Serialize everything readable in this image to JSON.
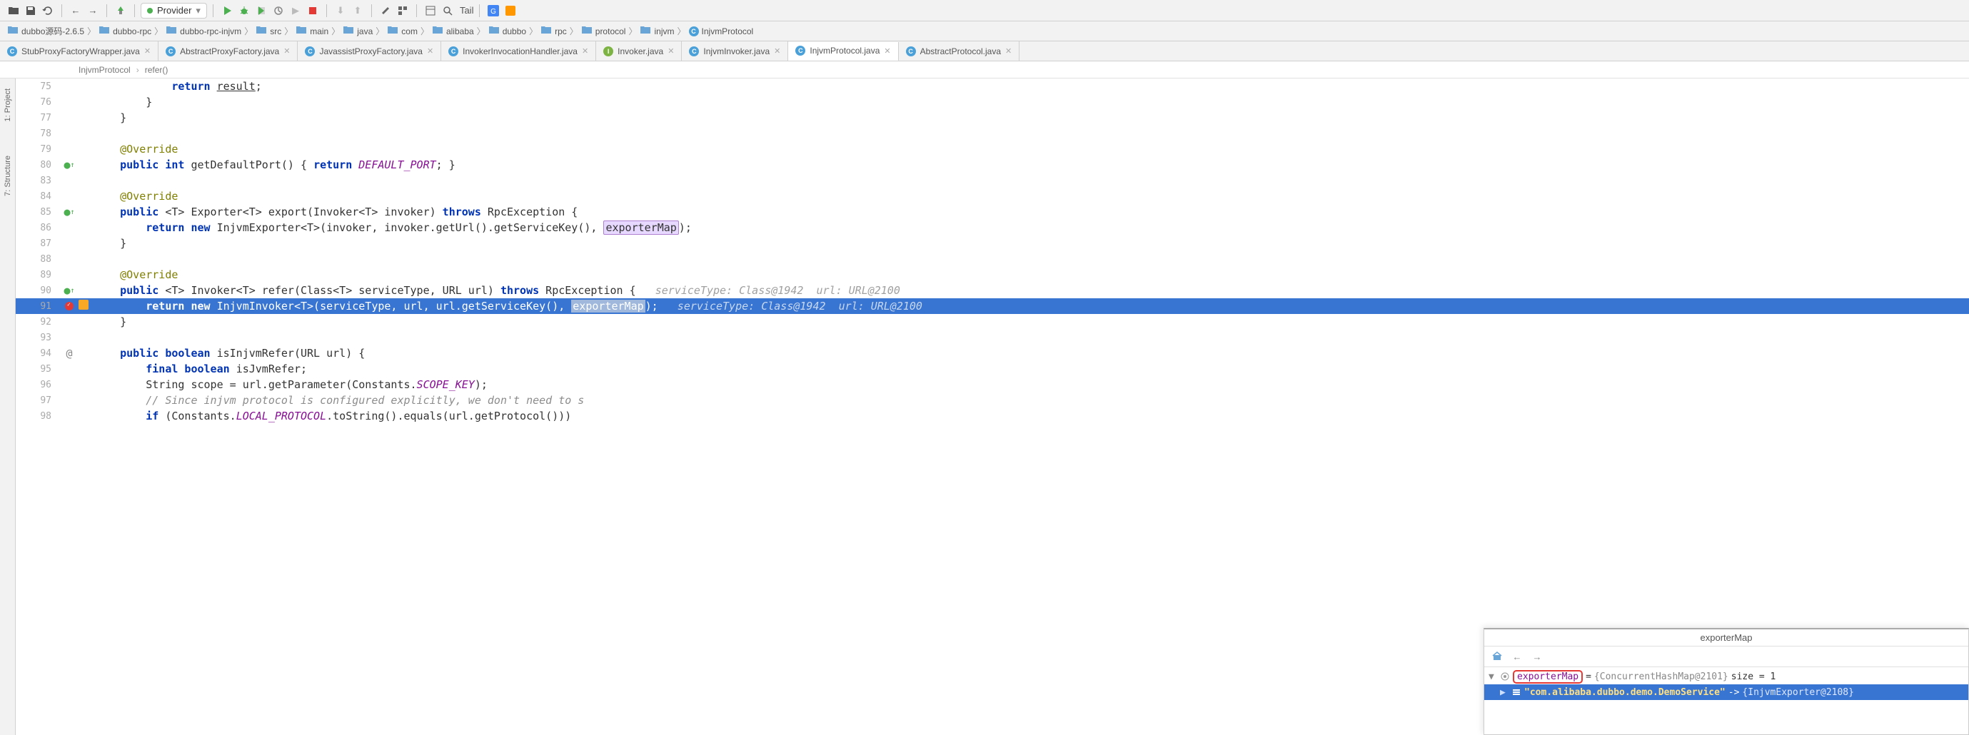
{
  "toolbar": {
    "run_config": "Provider",
    "search_text": "Tail"
  },
  "breadcrumbs": [
    {
      "icon": "folder",
      "label": "dubbo源码-2.6.5"
    },
    {
      "icon": "folder",
      "label": "dubbo-rpc"
    },
    {
      "icon": "folder",
      "label": "dubbo-rpc-injvm"
    },
    {
      "icon": "folder-src",
      "label": "src"
    },
    {
      "icon": "folder-src",
      "label": "main"
    },
    {
      "icon": "folder-src",
      "label": "java"
    },
    {
      "icon": "folder-pkg",
      "label": "com"
    },
    {
      "icon": "folder-pkg",
      "label": "alibaba"
    },
    {
      "icon": "folder-pkg",
      "label": "dubbo"
    },
    {
      "icon": "folder-pkg",
      "label": "rpc"
    },
    {
      "icon": "folder-pkg",
      "label": "protocol"
    },
    {
      "icon": "folder-pkg",
      "label": "injvm"
    },
    {
      "icon": "class",
      "label": "InjvmProtocol"
    }
  ],
  "tabs": [
    {
      "label": "StubProxyFactoryWrapper.java",
      "icon": "class",
      "active": false
    },
    {
      "label": "AbstractProxyFactory.java",
      "icon": "class",
      "active": false
    },
    {
      "label": "JavassistProxyFactory.java",
      "icon": "class",
      "active": false
    },
    {
      "label": "InvokerInvocationHandler.java",
      "icon": "class",
      "active": false
    },
    {
      "label": "Invoker.java",
      "icon": "interface",
      "active": false
    },
    {
      "label": "InjvmInvoker.java",
      "icon": "class",
      "active": false
    },
    {
      "label": "InjvmProtocol.java",
      "icon": "class",
      "active": true
    },
    {
      "label": "AbstractProtocol.java",
      "icon": "class",
      "active": false
    }
  ],
  "sub_crumb": {
    "class": "InjvmProtocol",
    "method": "refer()"
  },
  "side_tabs": [
    "1: Project",
    "7: Structure"
  ],
  "code_lines": [
    {
      "num": 75,
      "code": "            return result;",
      "tokens": [
        {
          "t": "            "
        },
        {
          "t": "return ",
          "c": "kw"
        },
        {
          "t": "result",
          "c": "underline"
        },
        {
          "t": ";"
        }
      ]
    },
    {
      "num": 76,
      "code": "        }"
    },
    {
      "num": 77,
      "code": "    }"
    },
    {
      "num": 78,
      "code": ""
    },
    {
      "num": 79,
      "code": "    @Override",
      "fold": true,
      "tokens": [
        {
          "t": "    "
        },
        {
          "t": "@Override",
          "c": "ann"
        }
      ]
    },
    {
      "num": 80,
      "marker": "override",
      "code": "    public int getDefaultPort() { return DEFAULT_PORT; }",
      "tokens": [
        {
          "t": "    "
        },
        {
          "t": "public int ",
          "c": "kw"
        },
        {
          "t": "getDefaultPort() { "
        },
        {
          "t": "return ",
          "c": "kw"
        },
        {
          "t": "DEFAULT_PORT",
          "c": "purple"
        },
        {
          "t": "; }"
        }
      ]
    },
    {
      "num": 83,
      "code": ""
    },
    {
      "num": 84,
      "code": "    @Override",
      "fold": true,
      "tokens": [
        {
          "t": "    "
        },
        {
          "t": "@Override",
          "c": "ann"
        }
      ]
    },
    {
      "num": 85,
      "marker": "override",
      "code": "    public <T> Exporter<T> export(Invoker<T> invoker) throws RpcException {",
      "tokens": [
        {
          "t": "    "
        },
        {
          "t": "public ",
          "c": "kw"
        },
        {
          "t": "<T> Exporter<T> export(Invoker<T> invoker) "
        },
        {
          "t": "throws ",
          "c": "kw"
        },
        {
          "t": "RpcException {"
        }
      ]
    },
    {
      "num": 86,
      "code": "        return new InjvmExporter<T>(invoker, invoker.getUrl().getServiceKey(), exporterMap);",
      "tokens": [
        {
          "t": "        "
        },
        {
          "t": "return new ",
          "c": "kw"
        },
        {
          "t": "InjvmExporter<T>(invoker, invoker.getUrl().getServiceKey(), "
        },
        {
          "t": "exporterMap",
          "c": "hl-box"
        },
        {
          "t": ");"
        }
      ]
    },
    {
      "num": 87,
      "code": "    }"
    },
    {
      "num": 88,
      "code": ""
    },
    {
      "num": 89,
      "code": "    @Override",
      "fold": true,
      "tokens": [
        {
          "t": "    "
        },
        {
          "t": "@Override",
          "c": "ann"
        }
      ]
    },
    {
      "num": 90,
      "marker": "override",
      "code": "    public <T> Invoker<T> refer(Class<T> serviceType, URL url) throws RpcException {",
      "tokens": [
        {
          "t": "    "
        },
        {
          "t": "public ",
          "c": "kw"
        },
        {
          "t": "<T> Invoker<T> refer(Class<T> serviceType, URL url) "
        },
        {
          "t": "throws ",
          "c": "kw"
        },
        {
          "t": "RpcException {   "
        },
        {
          "t": "serviceType: Class@1942  url: URL@2100",
          "c": "inline-hint"
        }
      ]
    },
    {
      "num": 91,
      "marker": "breakpoint",
      "highlighted": true,
      "code": "        return new InjvmInvoker<T>(serviceType, url, url.getServiceKey(), exporterMap);",
      "tokens": [
        {
          "t": "        "
        },
        {
          "t": "return new ",
          "c": "kw"
        },
        {
          "t": "InjvmInvoker<T>(serviceType, url, url.getServiceKey(), "
        },
        {
          "t": "exporterMap",
          "c": "hl-box2"
        },
        {
          "t": ");   "
        },
        {
          "t": "serviceType: Class@1942  url: URL@2100",
          "c": "inline-hint"
        }
      ]
    },
    {
      "num": 92,
      "code": "    }"
    },
    {
      "num": 93,
      "code": ""
    },
    {
      "num": 94,
      "marker": "at",
      "code": "    public boolean isInjvmRefer(URL url) {",
      "tokens": [
        {
          "t": "    "
        },
        {
          "t": "public boolean ",
          "c": "kw"
        },
        {
          "t": "isInjvmRefer(URL url) {"
        }
      ]
    },
    {
      "num": 95,
      "code": "        final boolean isJvmRefer;",
      "tokens": [
        {
          "t": "        "
        },
        {
          "t": "final boolean ",
          "c": "kw"
        },
        {
          "t": "isJvmRefer;"
        }
      ]
    },
    {
      "num": 96,
      "code": "        String scope = url.getParameter(Constants.SCOPE_KEY);",
      "tokens": [
        {
          "t": "        String scope = url.getParameter(Constants."
        },
        {
          "t": "SCOPE_KEY",
          "c": "purple"
        },
        {
          "t": ");"
        }
      ]
    },
    {
      "num": 97,
      "code": "        // Since injvm protocol is configured explicitly, we don't need to s",
      "tokens": [
        {
          "t": "        "
        },
        {
          "t": "// Since injvm protocol is configured explicitly, we don't need to s",
          "c": "cmt"
        }
      ]
    },
    {
      "num": 98,
      "code": "        if (Constants.LOCAL_PROTOCOL.toString().equals(url.getProtocol())) ",
      "tokens": [
        {
          "t": "        "
        },
        {
          "t": "if ",
          "c": "kw"
        },
        {
          "t": "(Constants."
        },
        {
          "t": "LOCAL_PROTOCOL",
          "c": "purple"
        },
        {
          "t": ".toString().equals(url.getProtocol())) "
        }
      ]
    }
  ],
  "debug": {
    "title": "exporterMap",
    "rows": [
      {
        "depth": 0,
        "expand": "▼",
        "key": "exporterMap",
        "eq": " = ",
        "val": "{ConcurrentHashMap@2101}",
        "size_label": " size = 1",
        "outlined": true,
        "selected": false
      },
      {
        "depth": 1,
        "expand": "▶",
        "key": "\"com.alibaba.dubbo.demo.DemoService\"",
        "arrow": " -> ",
        "val": "{InjvmExporter@2108}",
        "selected": true
      }
    ]
  }
}
